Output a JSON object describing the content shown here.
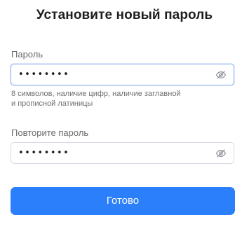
{
  "form": {
    "title": "Установите новый пароль",
    "password": {
      "label": "Пароль",
      "value": "••••••••",
      "toggle_icon": "eye-off-icon",
      "focused": true
    },
    "hint": {
      "line1": "8 символов, наличие цифр, наличие заглавной",
      "line2": "и прописной латиницы"
    },
    "confirm": {
      "label": "Повторите пароль",
      "value": "••••••••",
      "toggle_icon": "eye-off-icon"
    },
    "submit_label": "Готово"
  },
  "colors": {
    "accent": "#2b7ffb",
    "focus_border": "#8fb2ee",
    "border": "#d6dbe3",
    "label": "#6b6b6b"
  }
}
